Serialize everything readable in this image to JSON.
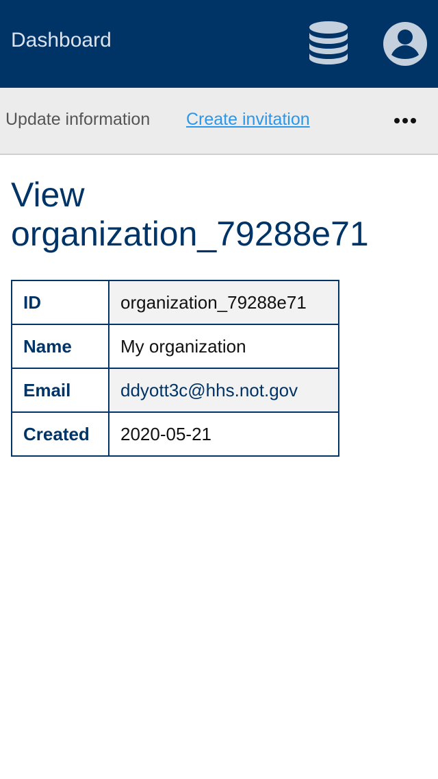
{
  "header": {
    "title": "Dashboard",
    "db_icon": "database-icon",
    "user_icon": "account-circle-icon"
  },
  "subnav": {
    "update_label": "Update information",
    "invite_label": "Create invitation",
    "more_icon": "more-horizontal-icon"
  },
  "page": {
    "title_line1": "View",
    "title_line2": "organization_79288e71"
  },
  "details": [
    {
      "key": "ID",
      "value": "organization_79288e71"
    },
    {
      "key": "Name",
      "value": "My organization"
    },
    {
      "key": "Email",
      "value": "ddyott3c@hhs.not.gov"
    },
    {
      "key": "Created",
      "value": "2020-05-21"
    }
  ],
  "colors": {
    "brand": "#003366",
    "link": "#2c97e8",
    "subnav_bg": "#ececec"
  }
}
